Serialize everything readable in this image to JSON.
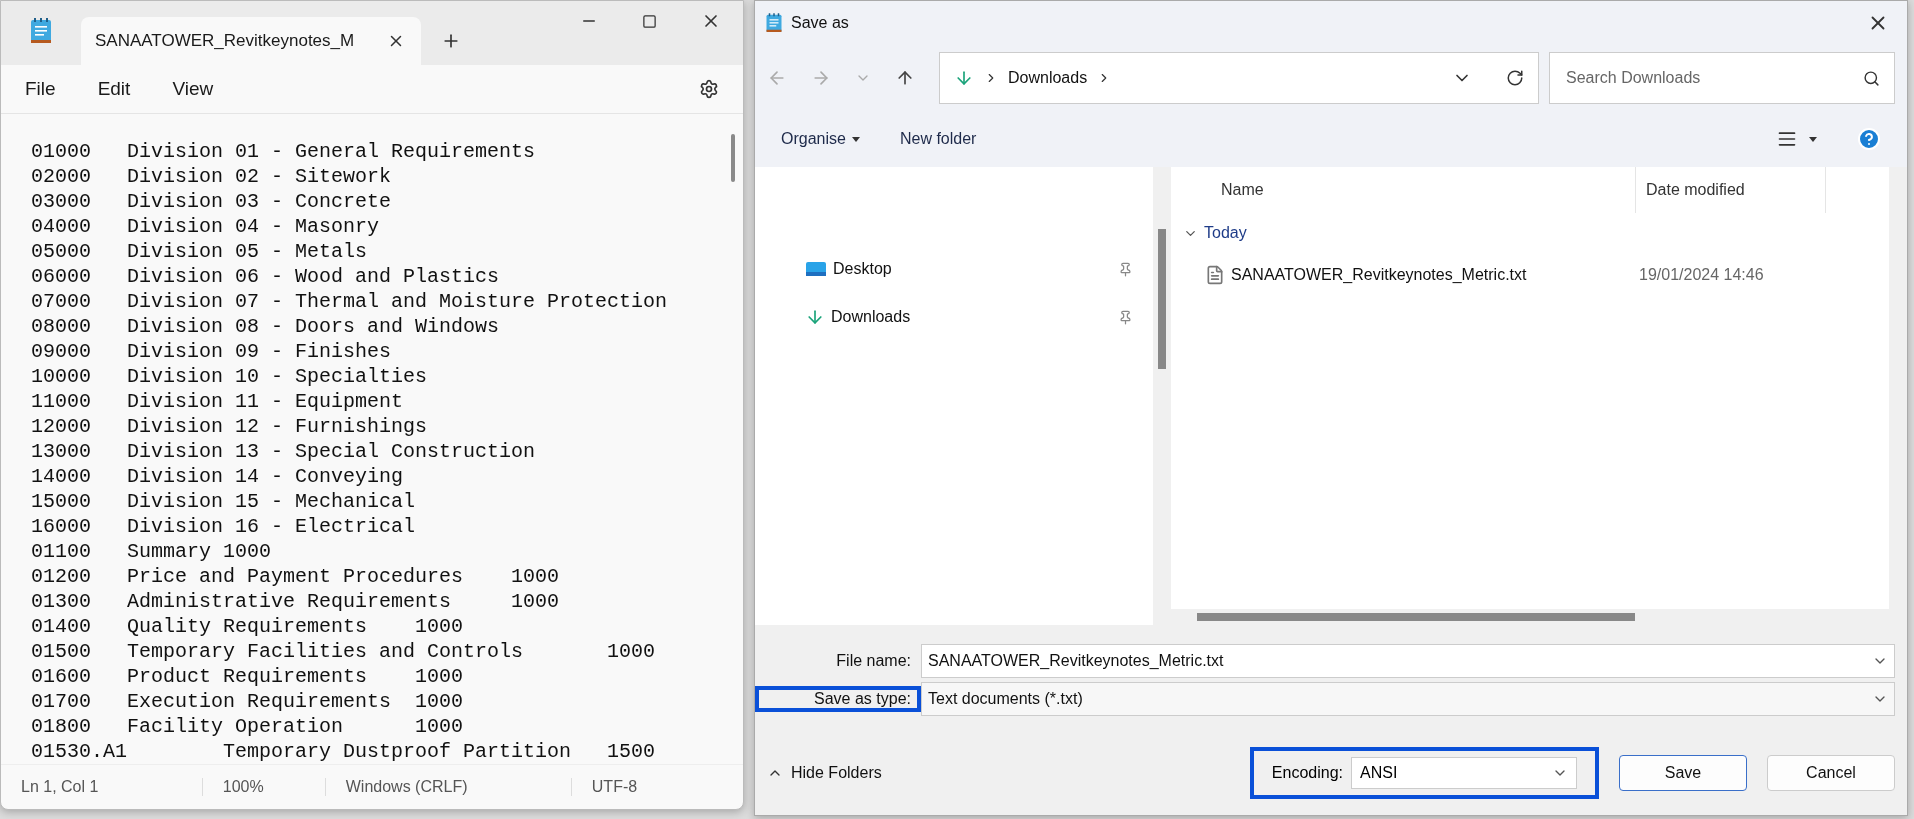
{
  "notepad": {
    "tab_title": "SANAATOWER_Revitkeynotes_M",
    "menu": [
      "File",
      "Edit",
      "View"
    ],
    "lines": [
      "01000\tDivision 01 - General Requirements",
      "02000\tDivision 02 - Sitework",
      "03000\tDivision 03 - Concrete",
      "04000\tDivision 04 - Masonry",
      "05000\tDivision 05 - Metals",
      "06000\tDivision 06 - Wood and Plastics",
      "07000\tDivision 07 - Thermal and Moisture Protection",
      "08000\tDivision 08 - Doors and Windows",
      "09000\tDivision 09 - Finishes",
      "10000\tDivision 10 - Specialties",
      "11000\tDivision 11 - Equipment",
      "12000\tDivision 12 - Furnishings",
      "13000\tDivision 13 - Special Construction",
      "14000\tDivision 14 - Conveying",
      "15000\tDivision 15 - Mechanical",
      "16000\tDivision 16 - Electrical",
      "01100\tSummary 1000",
      "01200\tPrice and Payment Procedures\t1000",
      "01300\tAdministrative Requirements\t1000",
      "01400\tQuality Requirements\t1000",
      "01500\tTemporary Facilities and Controls\t1000",
      "01600\tProduct Requirements\t1000",
      "01700\tExecution Requirements\t1000",
      "01800\tFacility Operation\t1000",
      "01530.A1\tTemporary Dustproof Partition\t1500"
    ],
    "status_bar": [
      "Ln 1, Col 1",
      "100%",
      "Windows (CRLF)",
      "UTF-8"
    ]
  },
  "dialog": {
    "title": "Save as",
    "address": [
      "Downloads"
    ],
    "search": {
      "placeholder": "Search Downloads"
    },
    "toolbar": [
      "Organise",
      "New folder"
    ],
    "nav": [
      {
        "label": "Desktop",
        "kind": "desktop"
      },
      {
        "label": "Downloads",
        "kind": "download"
      }
    ],
    "columns": [
      "Name",
      "Date modified"
    ],
    "groups": [
      {
        "label": "Today",
        "expanded": true,
        "files": [
          {
            "name": "SANAATOWER_Revitkeynotes_Metric.txt",
            "date": "19/01/2024 14:46"
          }
        ]
      }
    ],
    "fields": [
      {
        "label": "File name:",
        "value": "SANAATOWER_Revitkeynotes_Metric.txt",
        "highlighted": false
      },
      {
        "label": "Save as type:",
        "value": "Text documents (*.txt)",
        "highlighted": true
      }
    ],
    "hide_folders": "Hide Folders",
    "encoding": {
      "label": "Encoding:",
      "value": "ANSI",
      "highlighted": true
    },
    "buttons": [
      {
        "label": "Save",
        "default": true
      },
      {
        "label": "Cancel",
        "default": false
      }
    ]
  }
}
